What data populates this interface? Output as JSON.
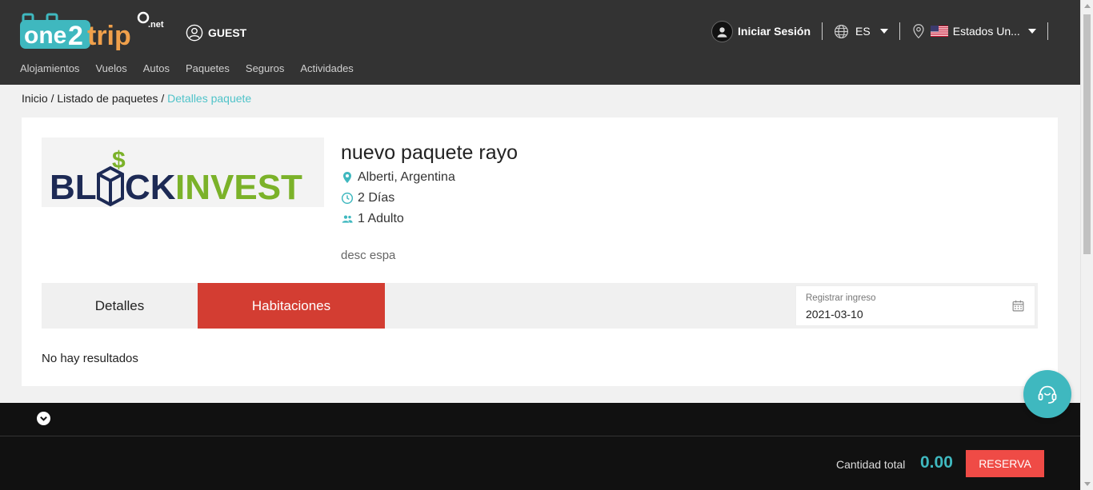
{
  "header": {
    "logo": {
      "part1": "one",
      "part2": "2",
      "part3": "trip",
      "suffix": ".net"
    },
    "guest_label": "GUEST",
    "nav": [
      "Alojamientos",
      "Vuelos",
      "Autos",
      "Paquetes",
      "Seguros",
      "Actividades"
    ],
    "login_label": "Iniciar Sesión",
    "language": "ES",
    "country": "Estados Un..."
  },
  "breadcrumb": {
    "home": "Inicio",
    "sep1": " / ",
    "list": "Listado de paquetes",
    "sep2": " / ",
    "current": "Detalles paquete"
  },
  "package": {
    "image_text_part1": "BL",
    "image_text_part2": "CK",
    "image_text_part3": "INVEST",
    "title": "nuevo paquete rayo",
    "location": "Alberti, Argentina",
    "duration": "2 Días",
    "travelers": "1 Adulto",
    "description": "desc espa"
  },
  "tabs": {
    "details": "Detalles",
    "rooms": "Habitaciones"
  },
  "checkin": {
    "label": "Registrar ingreso",
    "value": "2021-03-10"
  },
  "results": {
    "empty_message": "No hay resultados"
  },
  "footer": {
    "total_label": "Cantidad total",
    "total_value": "0.00",
    "reserve_label": "RESERVA"
  },
  "colors": {
    "accent": "#3fb8bf",
    "tab_active": "#d33d32",
    "reserve": "#ef4b46",
    "header_bg": "#333333"
  }
}
